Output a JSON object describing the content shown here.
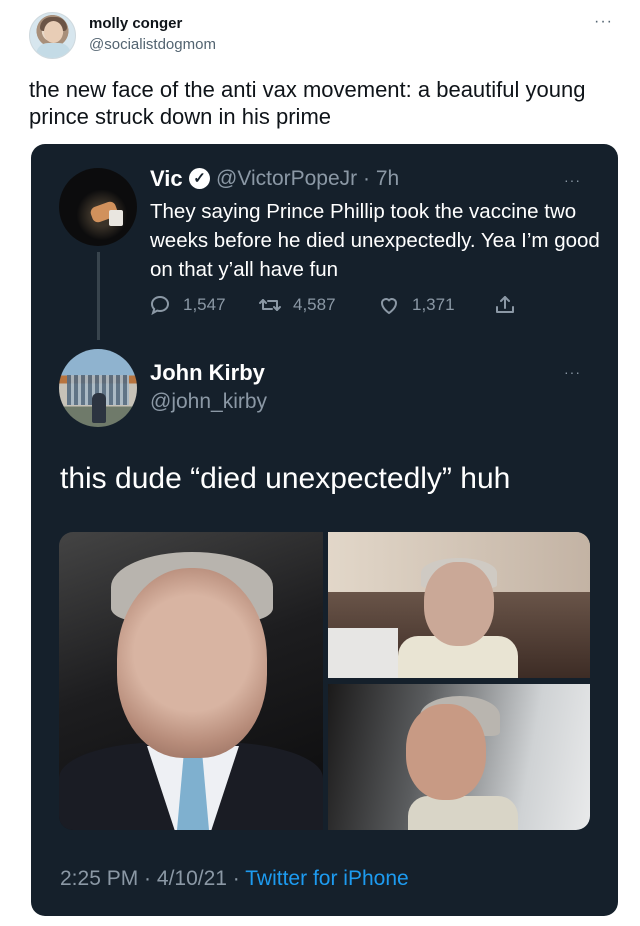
{
  "outer_tweet": {
    "display_name": "molly conger",
    "handle": "@socialistdogmom",
    "more_label": "···",
    "text": "the new face of the anti vax movement: a beautiful young prince struck down in his prime"
  },
  "quoted_tweet": {
    "display_name": "Vic",
    "verified_icon": "verified-badge",
    "handle_time": "@VictorPopeJr · 7h",
    "more_label": "···",
    "text": "They saying Prince Phillip took the vaccine two weeks before he died unexpectedly. Yea I’m good on that y’all have fun",
    "actions": {
      "reply_icon": "speech-bubble-icon",
      "reply_count": "1,547",
      "retweet_icon": "retweet-icon",
      "retweet_count": "4,587",
      "like_icon": "heart-icon",
      "like_count": "1,371",
      "share_icon": "share-icon"
    }
  },
  "reply": {
    "display_name": "John Kirby",
    "handle": "@john_kirby",
    "more_label": "···",
    "text": "this dude “died unexpectedly” huh",
    "photo_count": 3
  },
  "footer": {
    "time": "2:25 PM",
    "date": "4/10/21",
    "separator": " · ",
    "source": "Twitter for iPhone"
  },
  "colors": {
    "card_background": "#15202b",
    "muted_text": "#8b98a5",
    "link": "#1d9bf0"
  }
}
